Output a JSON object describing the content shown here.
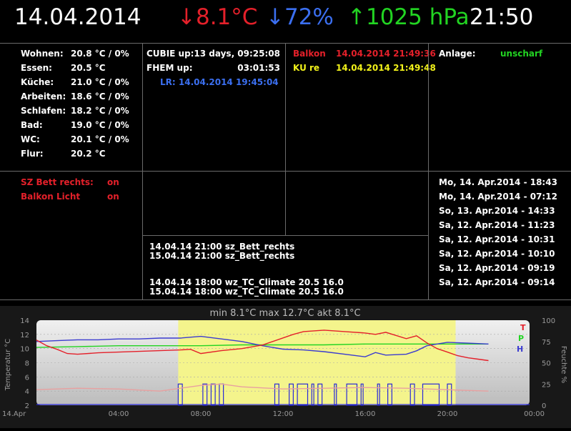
{
  "header": {
    "date": "14.04.2014",
    "temperature": "↓8.1°C",
    "humidity": "↓72%",
    "pressure": "↑1025 hPa",
    "time": "21:50"
  },
  "rooms": [
    {
      "name": "Wohnen:",
      "value": "20.8 °C  / 0%"
    },
    {
      "name": "Essen:",
      "value": "20.5 °C"
    },
    {
      "name": "Küche:",
      "value": "21.0 °C /  0%"
    },
    {
      "name": "Arbeiten:",
      "value": "18.6 °C  / 0%"
    },
    {
      "name": "Schlafen:",
      "value": "18.2 °C  / 0%"
    },
    {
      "name": "Bad:",
      "value": "19.0 °C  / 0%"
    },
    {
      "name": "WC:",
      "value": "20.1 °C  / 0%"
    },
    {
      "name": "Flur:",
      "value": "20.2 °C"
    }
  ],
  "system": {
    "cubie_label": "CUBIE up:",
    "cubie_value": "13 days, 09:25:08",
    "fhem_label": "FHEM up:",
    "fhem_value": "03:01:53",
    "lr": "LR: 14.04.2014 19:45:04"
  },
  "windows": [
    {
      "name": "Balkon",
      "time": "14.04.2014 21:49:36",
      "color": "#e4202a"
    },
    {
      "name": "KU re",
      "time": "14.04.2014 21:49:48",
      "color": "#f2f21a"
    }
  ],
  "alarm": {
    "label": "Anlage:",
    "value": "unscharf"
  },
  "devices": [
    {
      "name": "SZ Bett rechts:",
      "state": "on"
    },
    {
      "name": "Balkon Licht",
      "state": "on"
    }
  ],
  "timers": [
    "14.04.14 21:00 sz_Bett_rechts",
    "15.04.14 21:00 sz_Bett_rechts",
    "14.04.14 18:00 wz_TC_Climate 20.5 16.0",
    "15.04.14 18:00 wz_TC_Climate 20.5 16.0"
  ],
  "events": [
    "Mo, 14. Apr.2014 - 18:43",
    "Mo, 14. Apr.2014 - 07:12",
    "So, 13. Apr.2014 - 14:33",
    "Sa, 12. Apr.2014 - 11:23",
    "Sa, 12. Apr.2014 - 10:31",
    "Sa, 12. Apr.2014 - 10:10",
    "Sa, 12. Apr.2014 - 09:19",
    "Sa, 12. Apr.2014 - 09:14"
  ],
  "chart_data": {
    "type": "line",
    "title": "min 8.1°C max 12.7°C akt 8.1°C",
    "ylabel": "Temperatur °C",
    "y2label": "Feuchte %",
    "ylim": [
      2,
      14
    ],
    "y2lim": [
      0,
      100
    ],
    "yticks": [
      "2",
      "4",
      "6",
      "8",
      "10",
      "12",
      "14"
    ],
    "y2ticks": [
      "0",
      "25",
      "50",
      "75",
      "100"
    ],
    "xlim": [
      0,
      24
    ],
    "xticks": [
      {
        "x": 0,
        "label": "14.Apr"
      },
      {
        "x": 4,
        "label": "04:00"
      },
      {
        "x": 8,
        "label": "08:00"
      },
      {
        "x": 12,
        "label": "12:00"
      },
      {
        "x": 16,
        "label": "16:00"
      },
      {
        "x": 20,
        "label": "20:00"
      },
      {
        "x": 24,
        "label": "00:00"
      }
    ],
    "daylight": [
      6.9,
      20.4
    ],
    "legend": [
      {
        "label": "T",
        "color": "#e4202a"
      },
      {
        "label": "P",
        "color": "#22d422"
      },
      {
        "label": "H",
        "color": "#3b3bd0"
      }
    ],
    "colors": {
      "daylight": "#f4f48c",
      "plot_bg": "#d8d8d8",
      "panel_bg": "#181818"
    },
    "series": [
      {
        "color": "#e4202a",
        "axis": "left",
        "x": [
          0,
          0.5,
          1,
          1.5,
          2,
          3,
          4,
          5,
          6,
          7,
          7.5,
          8,
          9,
          10,
          11,
          12,
          12.5,
          13,
          14,
          15,
          16,
          16.5,
          17,
          18,
          18.5,
          19,
          19.5,
          20,
          20.5,
          21,
          21.5,
          22
        ],
        "y": [
          11.2,
          10.4,
          9.9,
          9.3,
          9.2,
          9.4,
          9.5,
          9.6,
          9.7,
          9.8,
          9.9,
          9.3,
          9.7,
          10.0,
          10.5,
          11.5,
          12.0,
          12.4,
          12.6,
          12.4,
          12.2,
          12.0,
          12.3,
          11.4,
          11.8,
          10.8,
          10.0,
          9.5,
          9.0,
          8.7,
          8.5,
          8.3
        ]
      },
      {
        "color": "#3b3bd0",
        "axis": "right",
        "x": [
          0,
          1,
          2,
          3,
          4,
          5,
          6,
          7,
          8,
          9,
          10,
          11,
          12,
          13,
          14,
          15,
          16,
          16.5,
          17,
          18,
          18.5,
          19,
          20,
          21,
          22
        ],
        "y": [
          75,
          76,
          77,
          77,
          78,
          78,
          79,
          79,
          81,
          78,
          75,
          70,
          66,
          65,
          63,
          60,
          57,
          62,
          59,
          60,
          64,
          70,
          74,
          73,
          72
        ]
      },
      {
        "color": "#22d422",
        "axis": "right",
        "x": [
          0,
          2,
          4,
          6,
          8,
          10,
          12,
          14,
          16,
          18,
          20,
          22
        ],
        "y": [
          68,
          69,
          70,
          70,
          70,
          71,
          71,
          71,
          72,
          72,
          72,
          72
        ]
      },
      {
        "color": "#e8a0a0",
        "axis": "left",
        "x": [
          0,
          2,
          4,
          6,
          8,
          9,
          10,
          12,
          14,
          16,
          18,
          20,
          22
        ],
        "y": [
          4.2,
          4.4,
          4.3,
          4.0,
          4.8,
          5.0,
          4.6,
          4.3,
          4.4,
          4.5,
          4.4,
          4.2,
          4.0
        ]
      }
    ],
    "switch_events": [
      [
        6.9,
        7.1
      ],
      [
        8.1,
        8.3
      ],
      [
        8.5,
        8.7
      ],
      [
        8.9,
        9.1
      ],
      [
        11.6,
        11.8
      ],
      [
        12.3,
        12.5
      ],
      [
        12.7,
        13.2
      ],
      [
        13.4,
        13.5
      ],
      [
        13.7,
        13.9
      ],
      [
        14.5,
        14.6
      ],
      [
        15.1,
        15.6
      ],
      [
        15.8,
        15.9
      ],
      [
        16.6,
        16.7
      ],
      [
        17.1,
        17.3
      ],
      [
        18.2,
        18.4
      ],
      [
        18.8,
        19.6
      ],
      [
        20.0,
        20.2
      ]
    ]
  }
}
